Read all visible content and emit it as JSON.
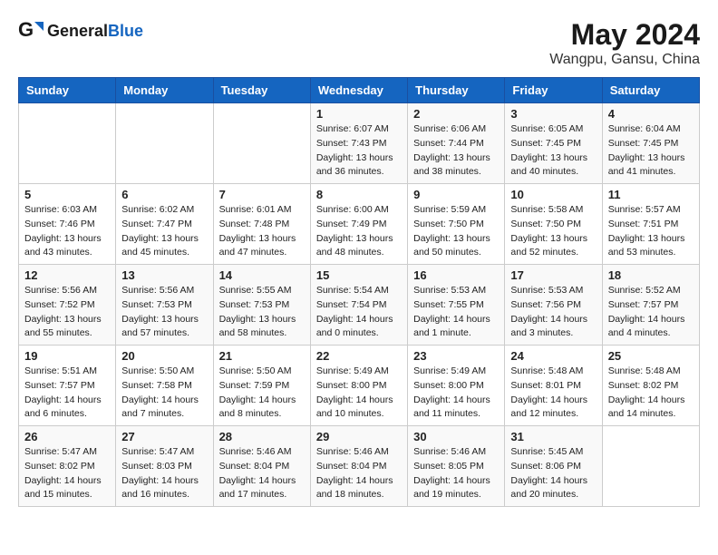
{
  "header": {
    "logo_general": "General",
    "logo_blue": "Blue",
    "title": "May 2024",
    "location": "Wangpu, Gansu, China"
  },
  "weekdays": [
    "Sunday",
    "Monday",
    "Tuesday",
    "Wednesday",
    "Thursday",
    "Friday",
    "Saturday"
  ],
  "weeks": [
    [
      {
        "day": "",
        "info": ""
      },
      {
        "day": "",
        "info": ""
      },
      {
        "day": "",
        "info": ""
      },
      {
        "day": "1",
        "info": "Sunrise: 6:07 AM\nSunset: 7:43 PM\nDaylight: 13 hours\nand 36 minutes."
      },
      {
        "day": "2",
        "info": "Sunrise: 6:06 AM\nSunset: 7:44 PM\nDaylight: 13 hours\nand 38 minutes."
      },
      {
        "day": "3",
        "info": "Sunrise: 6:05 AM\nSunset: 7:45 PM\nDaylight: 13 hours\nand 40 minutes."
      },
      {
        "day": "4",
        "info": "Sunrise: 6:04 AM\nSunset: 7:45 PM\nDaylight: 13 hours\nand 41 minutes."
      }
    ],
    [
      {
        "day": "5",
        "info": "Sunrise: 6:03 AM\nSunset: 7:46 PM\nDaylight: 13 hours\nand 43 minutes."
      },
      {
        "day": "6",
        "info": "Sunrise: 6:02 AM\nSunset: 7:47 PM\nDaylight: 13 hours\nand 45 minutes."
      },
      {
        "day": "7",
        "info": "Sunrise: 6:01 AM\nSunset: 7:48 PM\nDaylight: 13 hours\nand 47 minutes."
      },
      {
        "day": "8",
        "info": "Sunrise: 6:00 AM\nSunset: 7:49 PM\nDaylight: 13 hours\nand 48 minutes."
      },
      {
        "day": "9",
        "info": "Sunrise: 5:59 AM\nSunset: 7:50 PM\nDaylight: 13 hours\nand 50 minutes."
      },
      {
        "day": "10",
        "info": "Sunrise: 5:58 AM\nSunset: 7:50 PM\nDaylight: 13 hours\nand 52 minutes."
      },
      {
        "day": "11",
        "info": "Sunrise: 5:57 AM\nSunset: 7:51 PM\nDaylight: 13 hours\nand 53 minutes."
      }
    ],
    [
      {
        "day": "12",
        "info": "Sunrise: 5:56 AM\nSunset: 7:52 PM\nDaylight: 13 hours\nand 55 minutes."
      },
      {
        "day": "13",
        "info": "Sunrise: 5:56 AM\nSunset: 7:53 PM\nDaylight: 13 hours\nand 57 minutes."
      },
      {
        "day": "14",
        "info": "Sunrise: 5:55 AM\nSunset: 7:53 PM\nDaylight: 13 hours\nand 58 minutes."
      },
      {
        "day": "15",
        "info": "Sunrise: 5:54 AM\nSunset: 7:54 PM\nDaylight: 14 hours\nand 0 minutes."
      },
      {
        "day": "16",
        "info": "Sunrise: 5:53 AM\nSunset: 7:55 PM\nDaylight: 14 hours\nand 1 minute."
      },
      {
        "day": "17",
        "info": "Sunrise: 5:53 AM\nSunset: 7:56 PM\nDaylight: 14 hours\nand 3 minutes."
      },
      {
        "day": "18",
        "info": "Sunrise: 5:52 AM\nSunset: 7:57 PM\nDaylight: 14 hours\nand 4 minutes."
      }
    ],
    [
      {
        "day": "19",
        "info": "Sunrise: 5:51 AM\nSunset: 7:57 PM\nDaylight: 14 hours\nand 6 minutes."
      },
      {
        "day": "20",
        "info": "Sunrise: 5:50 AM\nSunset: 7:58 PM\nDaylight: 14 hours\nand 7 minutes."
      },
      {
        "day": "21",
        "info": "Sunrise: 5:50 AM\nSunset: 7:59 PM\nDaylight: 14 hours\nand 8 minutes."
      },
      {
        "day": "22",
        "info": "Sunrise: 5:49 AM\nSunset: 8:00 PM\nDaylight: 14 hours\nand 10 minutes."
      },
      {
        "day": "23",
        "info": "Sunrise: 5:49 AM\nSunset: 8:00 PM\nDaylight: 14 hours\nand 11 minutes."
      },
      {
        "day": "24",
        "info": "Sunrise: 5:48 AM\nSunset: 8:01 PM\nDaylight: 14 hours\nand 12 minutes."
      },
      {
        "day": "25",
        "info": "Sunrise: 5:48 AM\nSunset: 8:02 PM\nDaylight: 14 hours\nand 14 minutes."
      }
    ],
    [
      {
        "day": "26",
        "info": "Sunrise: 5:47 AM\nSunset: 8:02 PM\nDaylight: 14 hours\nand 15 minutes."
      },
      {
        "day": "27",
        "info": "Sunrise: 5:47 AM\nSunset: 8:03 PM\nDaylight: 14 hours\nand 16 minutes."
      },
      {
        "day": "28",
        "info": "Sunrise: 5:46 AM\nSunset: 8:04 PM\nDaylight: 14 hours\nand 17 minutes."
      },
      {
        "day": "29",
        "info": "Sunrise: 5:46 AM\nSunset: 8:04 PM\nDaylight: 14 hours\nand 18 minutes."
      },
      {
        "day": "30",
        "info": "Sunrise: 5:46 AM\nSunset: 8:05 PM\nDaylight: 14 hours\nand 19 minutes."
      },
      {
        "day": "31",
        "info": "Sunrise: 5:45 AM\nSunset: 8:06 PM\nDaylight: 14 hours\nand 20 minutes."
      },
      {
        "day": "",
        "info": ""
      }
    ]
  ]
}
